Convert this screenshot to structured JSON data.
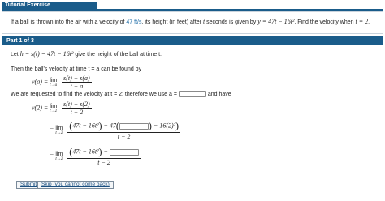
{
  "header": {
    "title": "Tutorial Exercise"
  },
  "problem": {
    "text_before": "If a ball is thrown into the air with a velocity of ",
    "velocity": "47 ft/s",
    "text_middle": ", its height (in feet) after ",
    "t_var": "t",
    "text_after_t": " seconds is given by ",
    "equation": "y = 47t − 16t²",
    "text_end": ". Find the velocity when ",
    "condition": "t = 2",
    "period": "."
  },
  "part": {
    "title": "Part 1 of 3",
    "step1_prefix": "Let",
    "step1_math": "h = s(t) = 47t − 16t²",
    "step1_suffix": "give the height of the ball at time t.",
    "step2_text": "Then the ball's velocity at time t = a can be found by",
    "step2_lhs": "v(a) =",
    "lim_label": "lim",
    "lim_sub_a": "t→a",
    "step2_num": "s(t) − s(a)",
    "step2_den": "t − a",
    "step3_text": "We are requested to find the velocity at t = 2; therefore we use a =",
    "step3_suffix": "and have",
    "step4_lhs": "v(2) =",
    "lim_sub_2": "t→2",
    "step4_num": "s(t) − s(2)",
    "step4_den": "t − 2",
    "step5_num_a": "47t − 16t²",
    "step5_num_b": "− 47",
    "step5_num_c": "− 16(2)²",
    "step5_den": "t − 2",
    "step6_lhs": "=",
    "step6_num_a": "47t − 16t²",
    "step6_num_b": "−",
    "step6_den": "t − 2"
  },
  "buttons": {
    "submit": "Submit",
    "skip": "Skip (you cannot come back)"
  },
  "colors": {
    "accent": "#1a5c8a",
    "highlight": "#1a6aa6"
  }
}
